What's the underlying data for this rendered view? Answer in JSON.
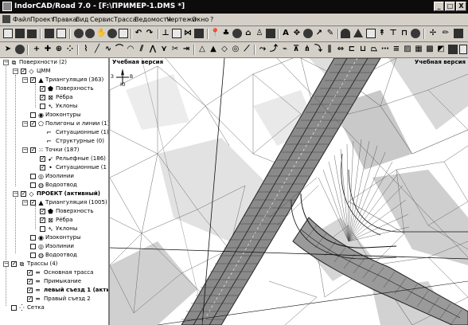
{
  "window": {
    "title": "IndorCAD/Road 7.0 - [F:\\ПРИМЕР-1.DMS *]",
    "controls": [
      "_",
      "□",
      "X"
    ]
  },
  "menu": [
    "Файл",
    "Проект",
    "Правка",
    "Вид",
    "Сервис",
    "Трасса",
    "Ведомости",
    "Чертежи",
    "Окно",
    "?"
  ],
  "tree": {
    "surfaces": "Поверхности (2)",
    "cmm": "ЦММ",
    "triangulation1": "Триангуляция (363)",
    "surface": "Поверхность",
    "edges": "Рёбра",
    "slopes": "Уклоны",
    "isocontours": "Изоконтуры",
    "polygons": "Полигоны и линии (1)",
    "situational": "Ситуационные (1)",
    "structural": "Структурные (0)",
    "points": "Точки (187)",
    "relief": "Рельефные (186)",
    "situational_pts": "Ситуационные (1",
    "isolines": "Изолинии",
    "drainage": "Водоотвод",
    "project": "ПРОЕКТ (активный)",
    "triangulation2": "Триангуляция (1005)",
    "routes": "Трассы (4)",
    "route1": "Основная трасса",
    "route2": "Примыкание",
    "route3": "левый съезд 1 (активн",
    "route4": "Правый съезд 2",
    "grid": "Сетка"
  },
  "canvas": {
    "watermark_left": "Учебная версия",
    "watermark_right": "Учебная версия",
    "compass": {
      "north": "С",
      "south": "Ю",
      "west": "З",
      "east": "В"
    }
  },
  "colors": {
    "titlebar": "#0c0c0c",
    "face": "#d4d0c8",
    "road": "#8a8a8a",
    "terrain_dark": "#b5b5b5",
    "terrain_light": "#e2e2e2"
  }
}
